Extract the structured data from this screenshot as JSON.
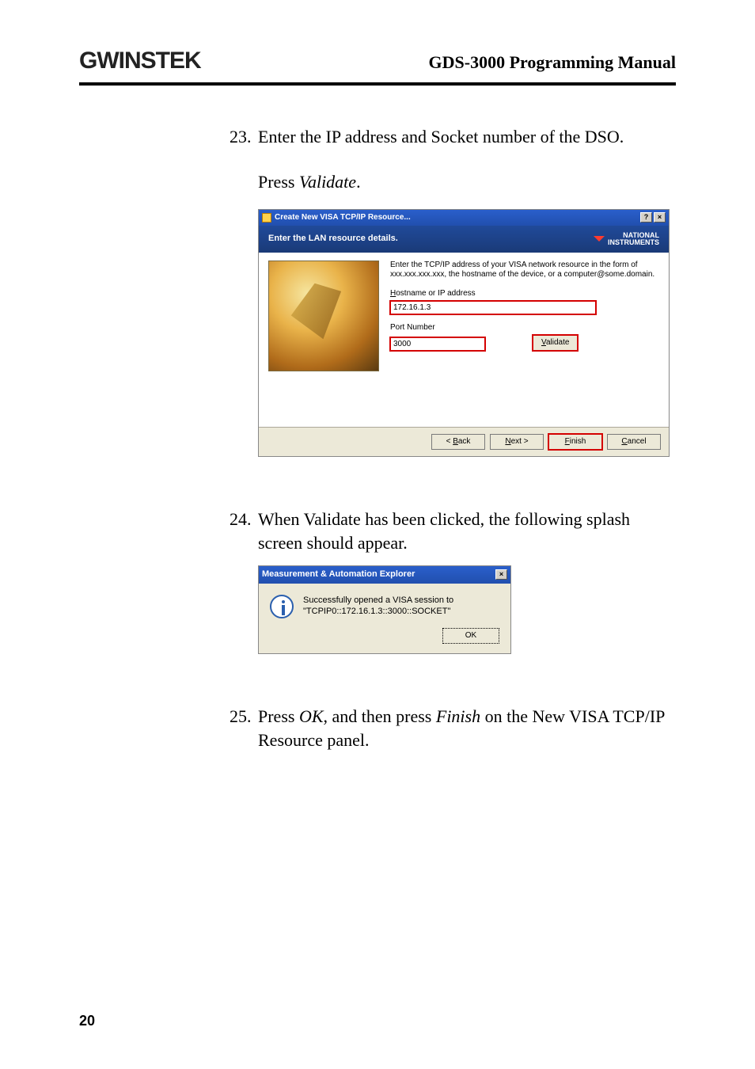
{
  "header": {
    "logo_text": "GWINSTEK",
    "manual_title": "GDS-3000 Programming Manual"
  },
  "step23": {
    "num": "23.",
    "line1": "Enter the IP address and Socket number of the DSO.",
    "line2_prefix": "Press ",
    "line2_italic": "Validate",
    "line2_suffix": "."
  },
  "wizard": {
    "title": "Create New VISA TCP/IP Resource...",
    "help_btn": "?",
    "close_btn": "×",
    "banner": "Enter the LAN resource details.",
    "ni_line1": "NATIONAL",
    "ni_line2": "INSTRUMENTS",
    "intro": "Enter the TCP/IP address of your VISA network resource in the form of xxx.xxx.xxx.xxx, the hostname of the device, or a computer@some.domain.",
    "hostname_label": "Hostname or IP address",
    "hostname_value": "172.16.1.3",
    "port_label": "Port Number",
    "port_value": "3000",
    "validate_label": "Validate",
    "back_label": "< Back",
    "next_label": "Next >",
    "finish_label": "Finish",
    "cancel_label": "Cancel"
  },
  "step24": {
    "num": "24.",
    "text": "When Validate has been clicked, the following splash screen should appear."
  },
  "splash": {
    "title": "Measurement & Automation Explorer",
    "close_btn": "×",
    "line1": "Successfully opened a VISA session to",
    "line2": "\"TCPIP0::172.16.1.3::3000::SOCKET\"",
    "ok_label": "OK"
  },
  "step25": {
    "num": "25.",
    "prefix": "Press ",
    "ok_italic": "OK",
    "mid": ", and then press ",
    "finish_italic": "Finish",
    "suffix": " on the New VISA TCP/IP Resource panel."
  },
  "page_number": "20"
}
